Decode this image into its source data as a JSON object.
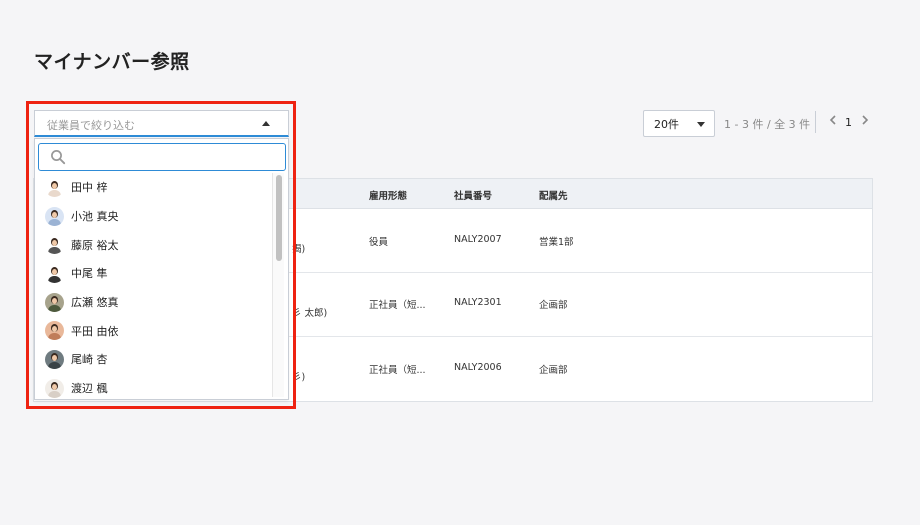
{
  "page": {
    "title": "マイナンバー参照"
  },
  "employee_filter": {
    "placeholder": "従業員で絞り込む",
    "search_value": "",
    "options": [
      {
        "name": "田中 梓",
        "avatar_bg": "#ffffff",
        "avatar_shirt": "#e9d9cc"
      },
      {
        "name": "小池 真央",
        "avatar_bg": "#d9e4f4",
        "avatar_shirt": "#9bb3d4"
      },
      {
        "name": "藤原 裕太",
        "avatar_bg": "#ffffff",
        "avatar_shirt": "#555555"
      },
      {
        "name": "中尾 隼",
        "avatar_bg": "#ffffff",
        "avatar_shirt": "#333333"
      },
      {
        "name": "広瀬 悠真",
        "avatar_bg": "#a7a38c",
        "avatar_shirt": "#4d5a3d"
      },
      {
        "name": "平田 由依",
        "avatar_bg": "#e9b89a",
        "avatar_shirt": "#c07d5a"
      },
      {
        "name": "尾崎 杏",
        "avatar_bg": "#6f7b80",
        "avatar_shirt": "#3a4347"
      },
      {
        "name": "渡辺 楓",
        "avatar_bg": "#f1ede8",
        "avatar_shirt": "#d8cfc6"
      }
    ]
  },
  "pagination": {
    "per_page": "20件",
    "range": "1 - 3 件 / 全 3 件",
    "current_page": "1",
    "prev_icon": "chevron-left-icon",
    "next_icon": "chevron-right-icon"
  },
  "table": {
    "headers": {
      "employment_type": "雇用形態",
      "employee_number": "社員番号",
      "department": "配属先"
    },
    "rows": [
      {
        "name_fragment": "揭)",
        "employment_type": "役員",
        "employee_number": "NALY2007",
        "department": "営業1部"
      },
      {
        "name_fragment": "彡 太郎)",
        "employment_type": "正社員（短...",
        "employee_number": "NALY2301",
        "department": "企画部"
      },
      {
        "name_fragment": "彡)",
        "employment_type": "正社員（短...",
        "employee_number": "NALY2006",
        "department": "企画部"
      }
    ]
  },
  "colors": {
    "highlight": "#ee2211",
    "focus": "#2e8bd6"
  }
}
